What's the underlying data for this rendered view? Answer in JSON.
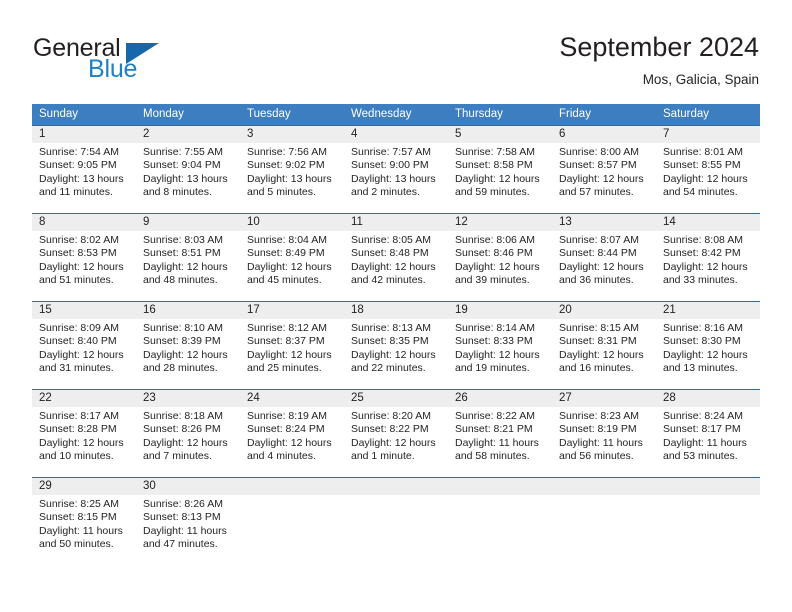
{
  "brand": {
    "word_one": "General",
    "word_two": "Blue",
    "triangle_color": "#1668ab",
    "blue_color": "#1f7fc4"
  },
  "header": {
    "title": "September 2024",
    "location": "Mos, Galicia, Spain"
  },
  "theme": {
    "header_blue": "#3c7ebf",
    "week_divider_blue": "#2e6da4",
    "day_band_gray": "#eeeeee",
    "text": "#231f20"
  },
  "weekdays": [
    "Sunday",
    "Monday",
    "Tuesday",
    "Wednesday",
    "Thursday",
    "Friday",
    "Saturday"
  ],
  "weeks": [
    {
      "numbers": [
        "1",
        "2",
        "3",
        "4",
        "5",
        "6",
        "7"
      ],
      "days": [
        {
          "sunrise": "Sunrise: 7:54 AM",
          "sunset": "Sunset: 9:05 PM",
          "daylight_1": "Daylight: 13 hours",
          "daylight_2": "and 11 minutes."
        },
        {
          "sunrise": "Sunrise: 7:55 AM",
          "sunset": "Sunset: 9:04 PM",
          "daylight_1": "Daylight: 13 hours",
          "daylight_2": "and 8 minutes."
        },
        {
          "sunrise": "Sunrise: 7:56 AM",
          "sunset": "Sunset: 9:02 PM",
          "daylight_1": "Daylight: 13 hours",
          "daylight_2": "and 5 minutes."
        },
        {
          "sunrise": "Sunrise: 7:57 AM",
          "sunset": "Sunset: 9:00 PM",
          "daylight_1": "Daylight: 13 hours",
          "daylight_2": "and 2 minutes."
        },
        {
          "sunrise": "Sunrise: 7:58 AM",
          "sunset": "Sunset: 8:58 PM",
          "daylight_1": "Daylight: 12 hours",
          "daylight_2": "and 59 minutes."
        },
        {
          "sunrise": "Sunrise: 8:00 AM",
          "sunset": "Sunset: 8:57 PM",
          "daylight_1": "Daylight: 12 hours",
          "daylight_2": "and 57 minutes."
        },
        {
          "sunrise": "Sunrise: 8:01 AM",
          "sunset": "Sunset: 8:55 PM",
          "daylight_1": "Daylight: 12 hours",
          "daylight_2": "and 54 minutes."
        }
      ]
    },
    {
      "numbers": [
        "8",
        "9",
        "10",
        "11",
        "12",
        "13",
        "14"
      ],
      "days": [
        {
          "sunrise": "Sunrise: 8:02 AM",
          "sunset": "Sunset: 8:53 PM",
          "daylight_1": "Daylight: 12 hours",
          "daylight_2": "and 51 minutes."
        },
        {
          "sunrise": "Sunrise: 8:03 AM",
          "sunset": "Sunset: 8:51 PM",
          "daylight_1": "Daylight: 12 hours",
          "daylight_2": "and 48 minutes."
        },
        {
          "sunrise": "Sunrise: 8:04 AM",
          "sunset": "Sunset: 8:49 PM",
          "daylight_1": "Daylight: 12 hours",
          "daylight_2": "and 45 minutes."
        },
        {
          "sunrise": "Sunrise: 8:05 AM",
          "sunset": "Sunset: 8:48 PM",
          "daylight_1": "Daylight: 12 hours",
          "daylight_2": "and 42 minutes."
        },
        {
          "sunrise": "Sunrise: 8:06 AM",
          "sunset": "Sunset: 8:46 PM",
          "daylight_1": "Daylight: 12 hours",
          "daylight_2": "and 39 minutes."
        },
        {
          "sunrise": "Sunrise: 8:07 AM",
          "sunset": "Sunset: 8:44 PM",
          "daylight_1": "Daylight: 12 hours",
          "daylight_2": "and 36 minutes."
        },
        {
          "sunrise": "Sunrise: 8:08 AM",
          "sunset": "Sunset: 8:42 PM",
          "daylight_1": "Daylight: 12 hours",
          "daylight_2": "and 33 minutes."
        }
      ]
    },
    {
      "numbers": [
        "15",
        "16",
        "17",
        "18",
        "19",
        "20",
        "21"
      ],
      "days": [
        {
          "sunrise": "Sunrise: 8:09 AM",
          "sunset": "Sunset: 8:40 PM",
          "daylight_1": "Daylight: 12 hours",
          "daylight_2": "and 31 minutes."
        },
        {
          "sunrise": "Sunrise: 8:10 AM",
          "sunset": "Sunset: 8:39 PM",
          "daylight_1": "Daylight: 12 hours",
          "daylight_2": "and 28 minutes."
        },
        {
          "sunrise": "Sunrise: 8:12 AM",
          "sunset": "Sunset: 8:37 PM",
          "daylight_1": "Daylight: 12 hours",
          "daylight_2": "and 25 minutes."
        },
        {
          "sunrise": "Sunrise: 8:13 AM",
          "sunset": "Sunset: 8:35 PM",
          "daylight_1": "Daylight: 12 hours",
          "daylight_2": "and 22 minutes."
        },
        {
          "sunrise": "Sunrise: 8:14 AM",
          "sunset": "Sunset: 8:33 PM",
          "daylight_1": "Daylight: 12 hours",
          "daylight_2": "and 19 minutes."
        },
        {
          "sunrise": "Sunrise: 8:15 AM",
          "sunset": "Sunset: 8:31 PM",
          "daylight_1": "Daylight: 12 hours",
          "daylight_2": "and 16 minutes."
        },
        {
          "sunrise": "Sunrise: 8:16 AM",
          "sunset": "Sunset: 8:30 PM",
          "daylight_1": "Daylight: 12 hours",
          "daylight_2": "and 13 minutes."
        }
      ]
    },
    {
      "numbers": [
        "22",
        "23",
        "24",
        "25",
        "26",
        "27",
        "28"
      ],
      "days": [
        {
          "sunrise": "Sunrise: 8:17 AM",
          "sunset": "Sunset: 8:28 PM",
          "daylight_1": "Daylight: 12 hours",
          "daylight_2": "and 10 minutes."
        },
        {
          "sunrise": "Sunrise: 8:18 AM",
          "sunset": "Sunset: 8:26 PM",
          "daylight_1": "Daylight: 12 hours",
          "daylight_2": "and 7 minutes."
        },
        {
          "sunrise": "Sunrise: 8:19 AM",
          "sunset": "Sunset: 8:24 PM",
          "daylight_1": "Daylight: 12 hours",
          "daylight_2": "and 4 minutes."
        },
        {
          "sunrise": "Sunrise: 8:20 AM",
          "sunset": "Sunset: 8:22 PM",
          "daylight_1": "Daylight: 12 hours",
          "daylight_2": "and 1 minute."
        },
        {
          "sunrise": "Sunrise: 8:22 AM",
          "sunset": "Sunset: 8:21 PM",
          "daylight_1": "Daylight: 11 hours",
          "daylight_2": "and 58 minutes."
        },
        {
          "sunrise": "Sunrise: 8:23 AM",
          "sunset": "Sunset: 8:19 PM",
          "daylight_1": "Daylight: 11 hours",
          "daylight_2": "and 56 minutes."
        },
        {
          "sunrise": "Sunrise: 8:24 AM",
          "sunset": "Sunset: 8:17 PM",
          "daylight_1": "Daylight: 11 hours",
          "daylight_2": "and 53 minutes."
        }
      ]
    },
    {
      "numbers": [
        "29",
        "30",
        "",
        "",
        "",
        "",
        ""
      ],
      "days": [
        {
          "sunrise": "Sunrise: 8:25 AM",
          "sunset": "Sunset: 8:15 PM",
          "daylight_1": "Daylight: 11 hours",
          "daylight_2": "and 50 minutes."
        },
        {
          "sunrise": "Sunrise: 8:26 AM",
          "sunset": "Sunset: 8:13 PM",
          "daylight_1": "Daylight: 11 hours",
          "daylight_2": "and 47 minutes."
        },
        {
          "sunrise": "",
          "sunset": "",
          "daylight_1": "",
          "daylight_2": ""
        },
        {
          "sunrise": "",
          "sunset": "",
          "daylight_1": "",
          "daylight_2": ""
        },
        {
          "sunrise": "",
          "sunset": "",
          "daylight_1": "",
          "daylight_2": ""
        },
        {
          "sunrise": "",
          "sunset": "",
          "daylight_1": "",
          "daylight_2": ""
        },
        {
          "sunrise": "",
          "sunset": "",
          "daylight_1": "",
          "daylight_2": ""
        }
      ]
    }
  ]
}
